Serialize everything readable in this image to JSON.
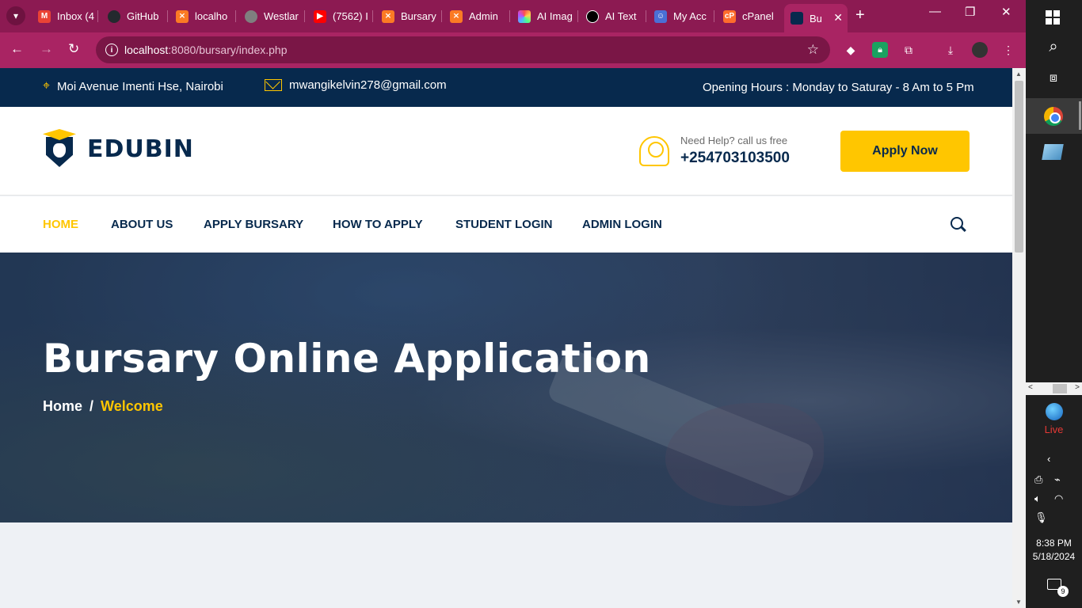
{
  "browser": {
    "tabs": [
      {
        "label": "Inbox (4",
        "icon": "gmail-icon",
        "color": "#ea4335"
      },
      {
        "label": "GitHub",
        "icon": "github-icon",
        "color": "#24292e"
      },
      {
        "label": "localho",
        "icon": "xampp-icon",
        "color": "#fb7a24"
      },
      {
        "label": "Westlar",
        "icon": "globe-icon",
        "color": "#7f7f7f"
      },
      {
        "label": "(7562) I",
        "icon": "youtube-icon",
        "color": "#ff0000"
      },
      {
        "label": "Bursary",
        "icon": "xampp-icon",
        "color": "#fb7a24"
      },
      {
        "label": "Admin",
        "icon": "xampp-icon",
        "color": "#fb7a24"
      },
      {
        "label": "AI Imag",
        "icon": "ai-image-icon",
        "color": "#7b61ff"
      },
      {
        "label": "AI Text",
        "icon": "openai-icon",
        "color": "#000000"
      },
      {
        "label": "My Acc",
        "icon": "account-icon",
        "color": "#4a6fd6"
      },
      {
        "label": "cPanel",
        "icon": "cpanel-icon",
        "color": "#ff6c2c"
      },
      {
        "label": "Bu",
        "icon": "edubin-icon",
        "color": "#07294d"
      }
    ],
    "url_host": "localhost",
    "url_rest": ":8080/bursary/index.php"
  },
  "site": {
    "topbar": {
      "address": "Moi Avenue Imenti Hse, Nairobi",
      "email": "mwangikelvin278@gmail.com",
      "hours": "Opening Hours : Monday to Saturay - 8 Am to 5 Pm"
    },
    "header": {
      "logo_text": "EDUBIN",
      "help_small": "Need Help? call us free",
      "phone": "+254703103500",
      "apply_label": "Apply Now"
    },
    "nav": [
      {
        "label": "HOME",
        "active": true
      },
      {
        "label": "ABOUT US",
        "active": false
      },
      {
        "label": "APPLY BURSARY",
        "active": false
      },
      {
        "label": "HOW TO APPLY",
        "active": false
      },
      {
        "label": "STUDENT LOGIN",
        "active": false
      },
      {
        "label": "ADMIN LOGIN",
        "active": false
      }
    ],
    "hero": {
      "title": "Bursary Online Application",
      "crumb_home": "Home",
      "crumb_sep": "/",
      "crumb_current": "Welcome"
    },
    "colors": {
      "navy": "#07294d",
      "accent": "#ffc600",
      "browser_accent": "#a92463"
    }
  },
  "taskbar": {
    "live_label": "Live",
    "time": "8:38 PM",
    "date": "5/18/2024",
    "notification_count": "9"
  }
}
